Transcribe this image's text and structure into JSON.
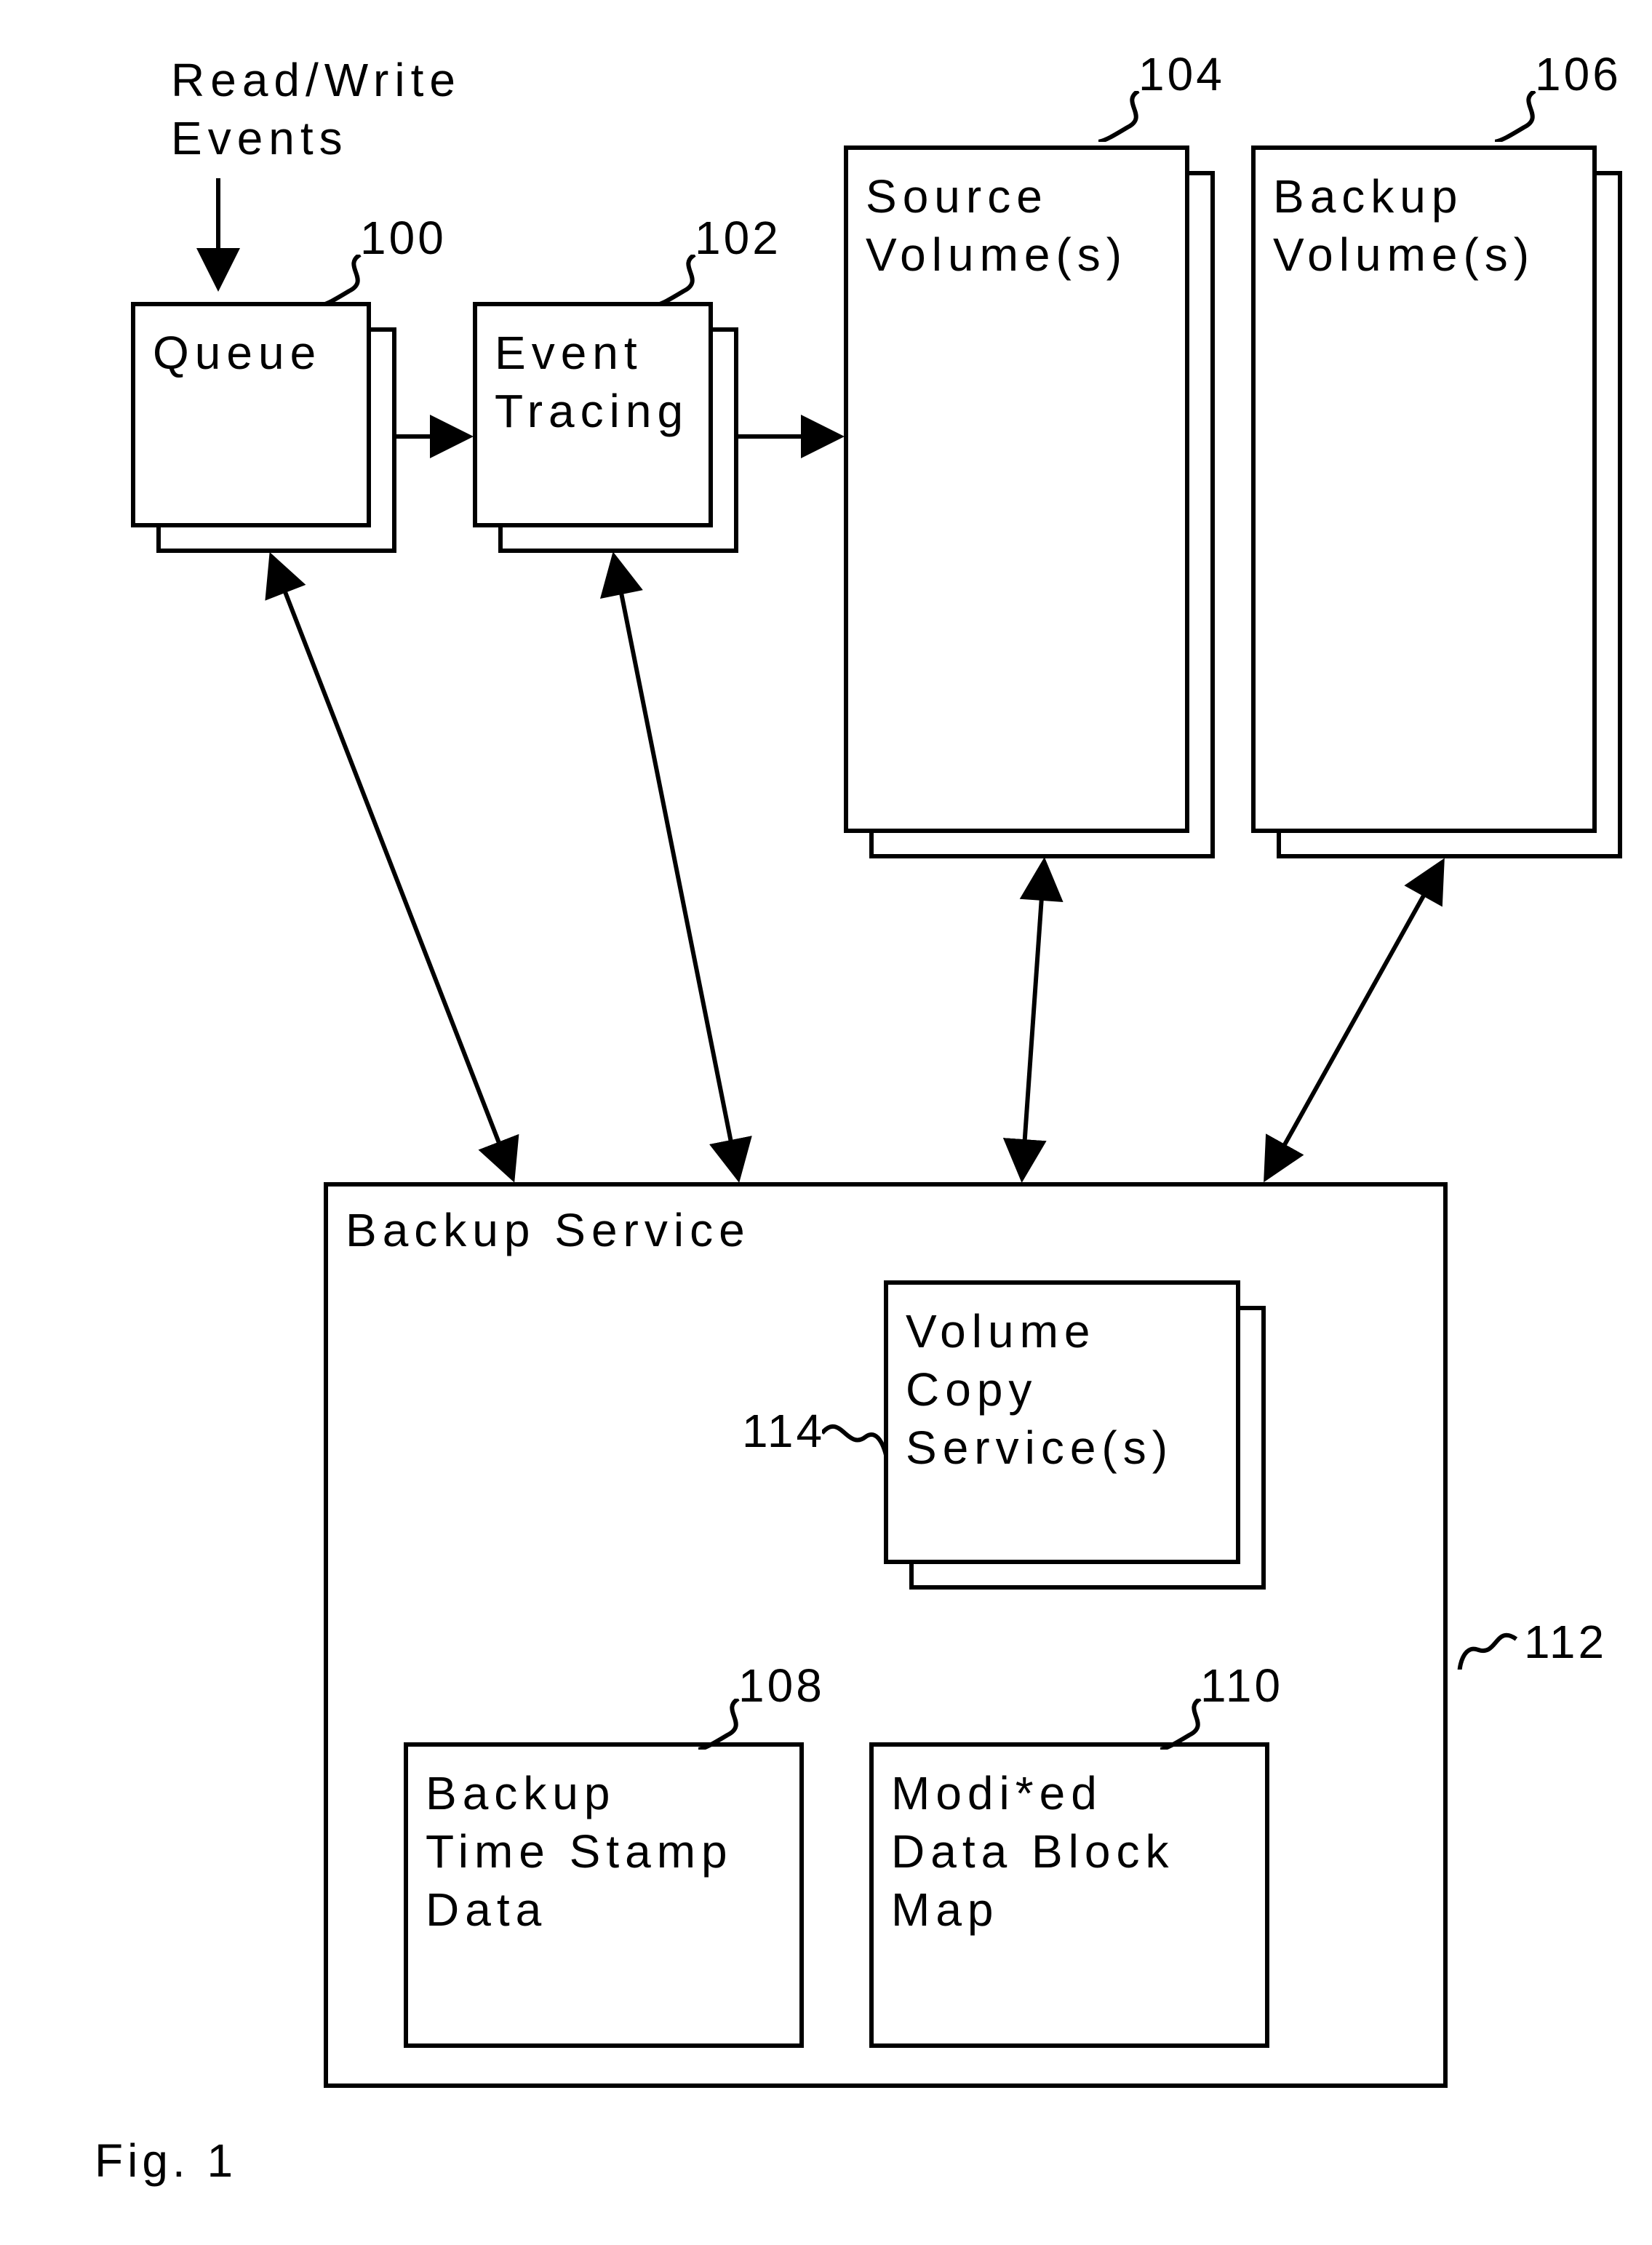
{
  "header_label": "Read/Write\nEvents",
  "refs": {
    "queue": "100",
    "event_tracing": "102",
    "source_volumes": "104",
    "backup_volumes": "106",
    "backup_ts": "108",
    "modified_map": "110",
    "backup_service": "112",
    "volume_copy": "114"
  },
  "boxes": {
    "queue": "Queue",
    "event_tracing": "Event\nTracing",
    "source_volumes": "Source\nVolume(s)",
    "backup_volumes": "Backup\nVolume(s)",
    "backup_service": "Backup Service",
    "volume_copy": "Volume\nCopy\nService(s)",
    "backup_ts": "Backup\nTime Stamp\nData",
    "modified_map": "Modi*ed\nData Block\nMap"
  },
  "figure_caption": "Fig. 1"
}
